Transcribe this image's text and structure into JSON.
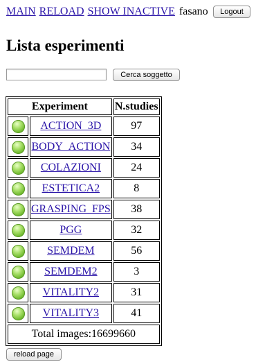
{
  "nav": {
    "main_label": "MAIN",
    "reload_label": "RELOAD",
    "show_inactive_label": "SHOW INACTIVE",
    "username": "fasano",
    "logout_label": "Logout"
  },
  "page_title": "Lista esperimenti",
  "search": {
    "value": "",
    "button_label": "Cerca soggetto"
  },
  "table": {
    "headers": {
      "experiment": "Experiment",
      "studies": "N.studies"
    },
    "rows": [
      {
        "name": "ACTION_3D",
        "studies": "97"
      },
      {
        "name": "BODY_ACTION",
        "studies": "34"
      },
      {
        "name": "COLAZIONI",
        "studies": "24"
      },
      {
        "name": "ESTETICA2",
        "studies": "8"
      },
      {
        "name": "GRASPING_FPS",
        "studies": "38"
      },
      {
        "name": "PGG",
        "studies": "32"
      },
      {
        "name": "SEMDEM",
        "studies": "56"
      },
      {
        "name": "SEMDEM2",
        "studies": "3"
      },
      {
        "name": "VITALITY2",
        "studies": "31"
      },
      {
        "name": "VITALITY3",
        "studies": "41"
      }
    ],
    "total_label": "Total images:16699660",
    "status_color": "#6fb92e"
  },
  "footer": {
    "reload_button_label": "reload page"
  }
}
